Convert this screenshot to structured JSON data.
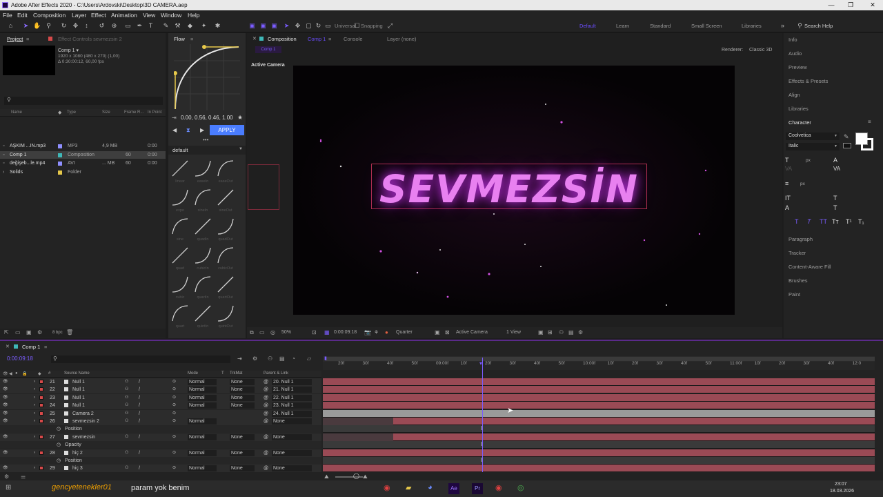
{
  "window": {
    "title": "Adobe After Effects 2020 - C:\\Users\\Ardovski\\Desktop\\3D CAMERA.aep",
    "minimize": "—",
    "maximize": "❐",
    "close": "✕"
  },
  "menu": [
    "File",
    "Edit",
    "Composition",
    "Layer",
    "Effect",
    "Animation",
    "View",
    "Window",
    "Help"
  ],
  "toolbar": {
    "axis": "Universal",
    "snapping": "Snapping",
    "workspaces": [
      "Default",
      "Learn",
      "Standard",
      "Small Screen",
      "Libraries"
    ],
    "search": "Search Help"
  },
  "project": {
    "tab": "Project",
    "effect_tab": "Effect Controls sevmezsin 2",
    "comp_name": "Comp 1 ▾",
    "comp_info1": "1920 x 1080  (480 x 270) (1,00)",
    "comp_info2": "Δ 0:30:00:12, 60,00 fps",
    "cols": [
      "Name",
      "Type",
      "Size",
      "Frame R...",
      "In Point"
    ],
    "items": [
      {
        "name": "AŞKIM ...IN.mp3",
        "type": "MP3",
        "size": "4,9 MB",
        "fr": "",
        "inp": "0:00",
        "color": "#8f8fff"
      },
      {
        "name": "Comp 1",
        "type": "Composition",
        "size": "",
        "fr": "60",
        "inp": "0:00",
        "color": "#3fb8b8"
      },
      {
        "name": "değişeb...le.mp4",
        "type": "AVI",
        "size": "... MB",
        "fr": "60",
        "inp": "0:00",
        "color": "#8f8fff"
      },
      {
        "name": "Solids",
        "type": "Folder",
        "size": "",
        "fr": "",
        "inp": "",
        "color": "#e6c84a"
      }
    ],
    "bpc": "8 bpc"
  },
  "flow": {
    "tab": "Flow",
    "values": "0.00, 0.56, 0.46, 1.00",
    "apply": "APPLY",
    "preset": "default",
    "eases": [
      [
        "linear",
        "easeIn",
        "easeOut"
      ],
      [
        "expo",
        "sineIn",
        "sineOut"
      ],
      [
        "sine",
        "quadIn",
        "quadOut"
      ],
      [
        "quad",
        "cubicIn",
        "cubicOut"
      ],
      [
        "cubic",
        "quartIn",
        "quartOut"
      ],
      [
        "quart",
        "quintIn",
        "quintOut"
      ]
    ]
  },
  "composition": {
    "tab": "Composition",
    "tab2": "Comp 1",
    "console": "Console",
    "layer": "Layer (none)",
    "renderer_label": "Renderer:",
    "renderer": "Classic 3D",
    "active_camera": "Active Camera",
    "text": "SEVMEZSİN",
    "footer": {
      "zoom": "50%",
      "time": "0:00:09:18",
      "res": "Quarter",
      "view": "Active Camera",
      "views": "1 View"
    }
  },
  "right": {
    "items": [
      "Info",
      "Audio",
      "Preview",
      "Effects & Presets",
      "Align",
      "Libraries"
    ],
    "character": "Character",
    "font": "Coolvetica",
    "style": "Italic",
    "px1": "px",
    "px2": "px",
    "after": [
      "Paragraph",
      "Tracker",
      "Content-Aware Fill",
      "Brushes",
      "Paint"
    ],
    "tt": [
      "T",
      "T",
      "TT",
      "Tт",
      "T¹",
      "T₁"
    ]
  },
  "timeline": {
    "tab": "Comp 1",
    "timecode": "0:00:09:18",
    "cols": {
      "src": "Source Name",
      "mode": "Mode",
      "t": "T",
      "trk": "TrkMat",
      "parent": "Parent & Link"
    },
    "ticks": [
      "20f",
      "30f",
      "40f",
      "50f",
      "09:00f",
      "10f",
      "20f",
      "30f",
      "40f",
      "50f",
      "10:00f",
      "10f",
      "20f",
      "30f",
      "40f",
      "50f",
      "11:00f",
      "10f",
      "20f",
      "30f",
      "40f",
      "12:0"
    ],
    "layers": [
      {
        "num": "21",
        "name": "Null 1",
        "mode": "Normal",
        "trk": "None",
        "parent": "20. Null 1",
        "color": "#d74a4a"
      },
      {
        "num": "22",
        "name": "Null 1",
        "mode": "Normal",
        "trk": "None",
        "parent": "21. Null 1",
        "color": "#d74a4a"
      },
      {
        "num": "23",
        "name": "Null 1",
        "mode": "Normal",
        "trk": "None",
        "parent": "22. Null 1",
        "color": "#d74a4a"
      },
      {
        "num": "24",
        "name": "Null 1",
        "mode": "Normal",
        "trk": "None",
        "parent": "23. Null 1",
        "color": "#d74a4a"
      },
      {
        "num": "25",
        "name": "Camera 2",
        "mode": "",
        "trk": "",
        "parent": "24. Null 1",
        "color": "#d74a4a"
      },
      {
        "num": "26",
        "name": "sevmezsin 2",
        "mode": "Normal",
        "trk": "",
        "parent": "None",
        "color": "#d74a4a"
      },
      {
        "num": "",
        "name": "Position",
        "mode": "",
        "trk": "",
        "parent": "",
        "color": ""
      },
      {
        "num": "27",
        "name": "sevmezsin",
        "mode": "Normal",
        "trk": "None",
        "parent": "None",
        "color": "#d74a4a"
      },
      {
        "num": "",
        "name": "Opacity",
        "mode": "",
        "trk": "",
        "parent": "",
        "color": ""
      },
      {
        "num": "28",
        "name": "hiç 2",
        "mode": "Normal",
        "trk": "None",
        "parent": "None",
        "color": "#d74a4a"
      },
      {
        "num": "",
        "name": "Position",
        "mode": "",
        "trk": "",
        "parent": "",
        "color": ""
      },
      {
        "num": "29",
        "name": "hiç 3",
        "mode": "Normal",
        "trk": "None",
        "parent": "None",
        "color": "#d74a4a"
      }
    ]
  },
  "taskbar": {
    "user": "gencyetenekler01",
    "song": "param yok benim",
    "time": "23:07",
    "date": "18.03.2026"
  }
}
